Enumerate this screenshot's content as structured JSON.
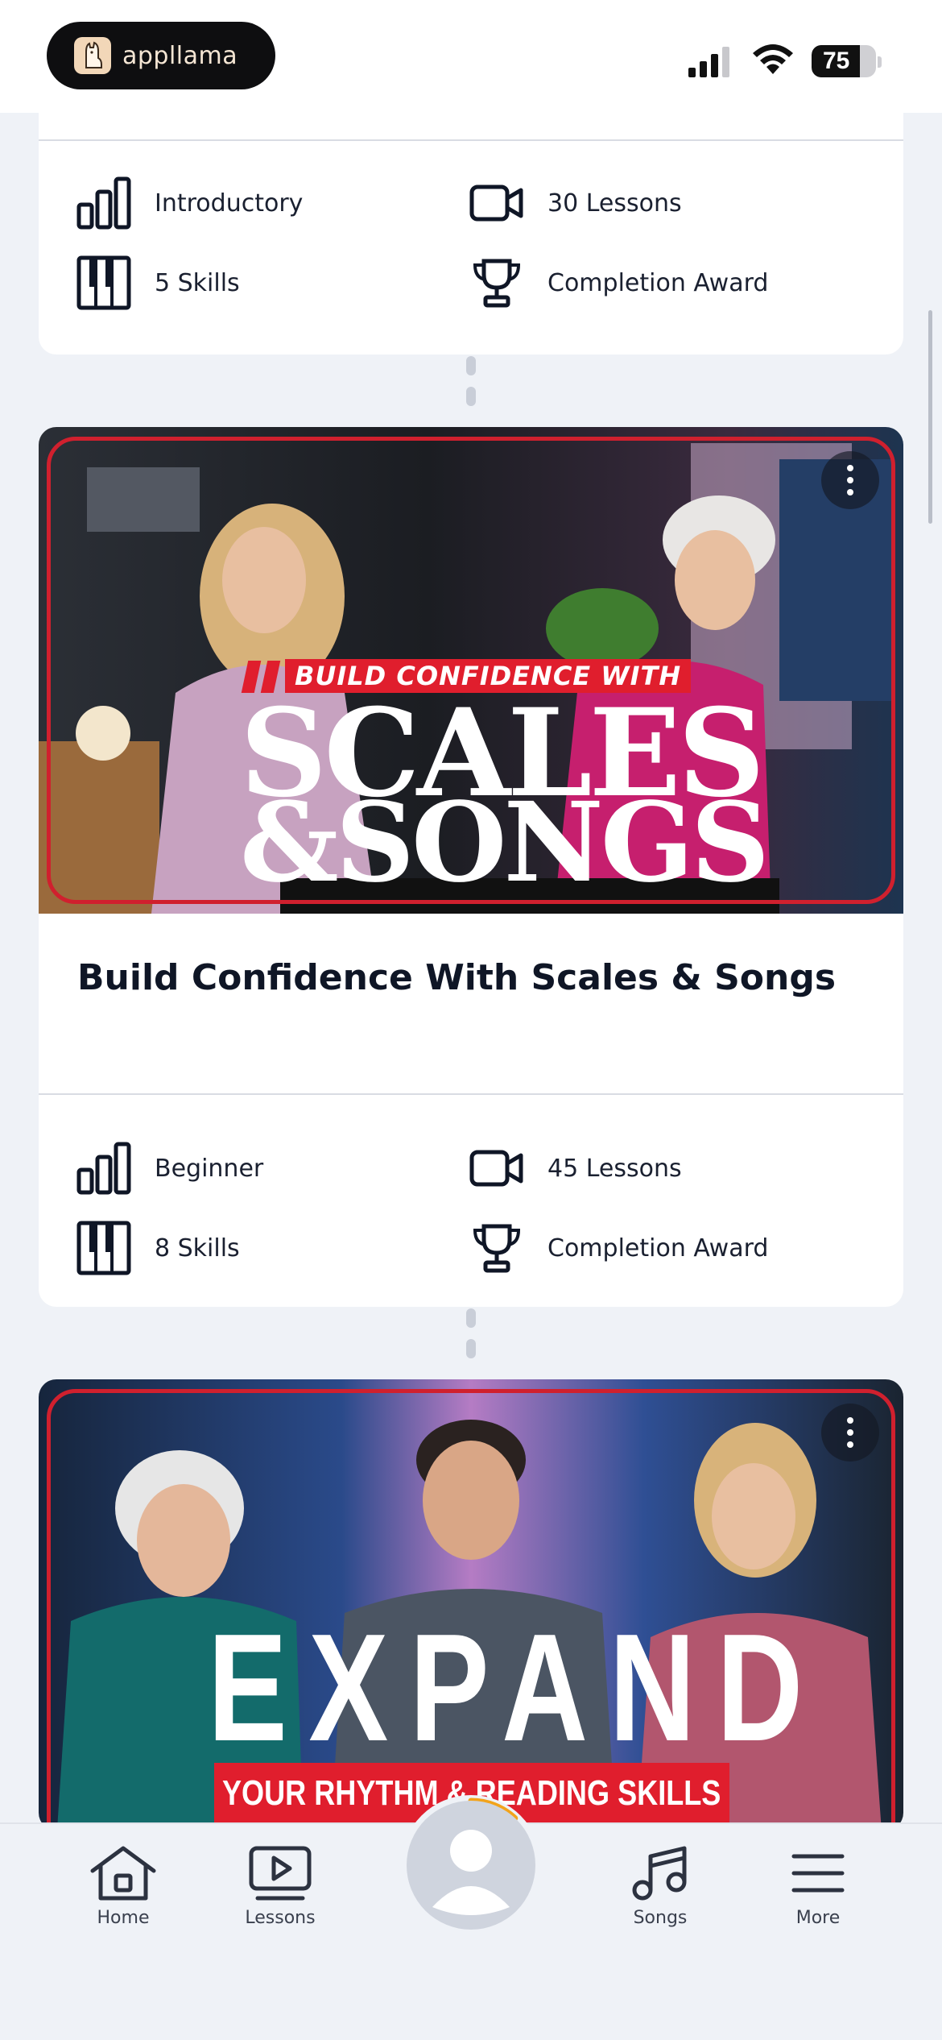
{
  "status_bar": {
    "app_name": "appllama",
    "battery": "75",
    "battery_level": 0.75
  },
  "top_card": {
    "stats": {
      "level": "Introductory",
      "lessons": "30 Lessons",
      "skills": "5 Skills",
      "award": "Completion Award"
    }
  },
  "course_card": {
    "thumbnail": {
      "banner": "BUILD CONFIDENCE WITH",
      "line1": "SCALES",
      "line2": "&SONGS"
    },
    "title": "Build Confidence With Scales & Songs",
    "stats": {
      "level": "Beginner",
      "lessons": "45 Lessons",
      "skills": "8 Skills",
      "award": "Completion Award"
    }
  },
  "next_card": {
    "thumbnail": {
      "headline": "EXPAND",
      "banner": "YOUR RHYTHM & READING SKILLS"
    }
  },
  "bottom_nav": {
    "home": "Home",
    "lessons": "Lessons",
    "songs": "Songs",
    "more": "More",
    "progress": 0.12
  },
  "colors": {
    "accent_red": "#d0202e",
    "progress_ring": "#f2a31b",
    "background": "#eff2f7"
  }
}
